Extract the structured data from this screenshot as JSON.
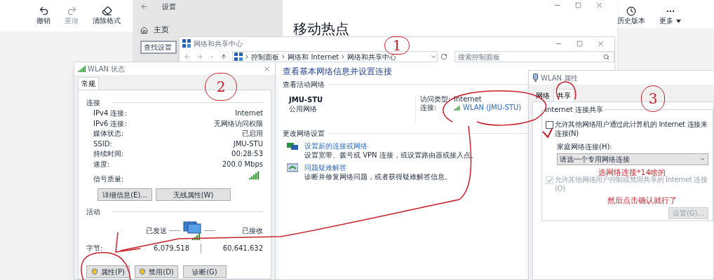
{
  "editor": {
    "toolbar": [
      {
        "kind": "undo",
        "label": "撤销",
        "disabled": false
      },
      {
        "kind": "redo",
        "label": "重做",
        "disabled": true
      },
      {
        "kind": "clear",
        "label": "清除格式",
        "disabled": false
      }
    ],
    "toolbar_right": [
      {
        "kind": "history",
        "label": "历史版本"
      },
      {
        "kind": "more",
        "label": "更多"
      }
    ]
  },
  "settings_window": {
    "title": "设置",
    "nav": [
      {
        "label": "主页"
      }
    ],
    "search": {
      "placeholder": "查找设置"
    },
    "page_title": "移动热点"
  },
  "network_center": {
    "title": "网络和共享中心",
    "breadcrumb": [
      "控制面板",
      "网络和 Internet",
      "网络和共享中心"
    ],
    "search": {
      "placeholder": "搜索控制面板"
    },
    "heading": "查看基本网络信息并设置连接",
    "active_networks_label": "查看活动网络",
    "network": {
      "name": "JMU-STU",
      "category": "公用网络",
      "access_type_label": "访问类型:",
      "access_type": "Internet",
      "connection_label": "连接:",
      "connection": "WLAN (JMU-STU)"
    },
    "change_settings_label": "更改网络设置",
    "tasks": [
      {
        "kind": "new",
        "link": "设置新的连接或网络",
        "description": "设置宽带、拨号或 VPN 连接，或设置路由器或接入点。"
      },
      {
        "kind": "troubleshoot",
        "link": "问题疑难解答",
        "description": "诊断并修复网络问题，或者获得疑难解答信息。"
      }
    ]
  },
  "wlan_status": {
    "title": "WLAN 状态",
    "tabs": [
      {
        "label": "常规",
        "selected": true
      }
    ],
    "connection_label": "连接",
    "rows": [
      {
        "label": "IPv4 连接:",
        "value": "Internet"
      },
      {
        "label": "IPv6 连接:",
        "value": "无网络访问权限"
      },
      {
        "label": "媒体状态:",
        "value": "已启用"
      },
      {
        "label": "SSID:",
        "value": "JMU-STU"
      },
      {
        "label": "持续时间:",
        "value": "00:28:53"
      },
      {
        "label": "速度:",
        "value": "200.0 Mbps"
      }
    ],
    "signal_label": "信号质量:",
    "buttons": [
      "详细信息(E)...",
      "无线属性(W)"
    ],
    "activity_label": "活动",
    "sent_label": "已发送",
    "received_label": "已接收",
    "bytes_label": "字节:",
    "bytes_sent": "6,079,518",
    "bytes_received": "60,641,632",
    "footer_buttons": [
      {
        "label": "属性(P)",
        "shield": true
      },
      {
        "label": "禁用(D)",
        "shield": true
      },
      {
        "label": "诊断(G)",
        "shield": false
      }
    ]
  },
  "wlan_properties": {
    "title": "WLAN 属性",
    "tabs": [
      {
        "label": "网络",
        "selected": false
      },
      {
        "label": "共享",
        "selected": true
      }
    ],
    "group_label": "Internet 连接共享",
    "allow_sharing": {
      "label": "允许其他网络用户通过此计算机的 Internet 连接来连接(N)",
      "checked": false,
      "disabled": false
    },
    "home_label": "家庭网络连接(H):",
    "home_select": {
      "value": "请选一个专用网络连接"
    },
    "allow_control": {
      "label": "允许其他网络用户控制或禁用共享的 Internet 连接(O)",
      "checked": true,
      "disabled": true
    },
    "settings_button": {
      "label": "设置(G)...",
      "disabled": true
    }
  },
  "annotations": {
    "numbers": [
      "1",
      "2",
      "3"
    ],
    "notes": [
      "选网络连接*14啥的",
      "然后点击确认就行了"
    ]
  }
}
